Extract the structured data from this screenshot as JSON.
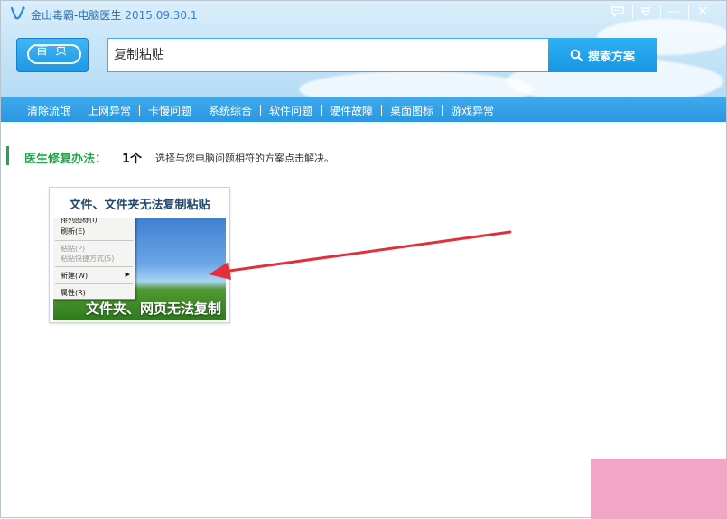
{
  "window": {
    "app_title": "金山毒霸-电脑医生",
    "version": "2015.09.30.1",
    "controls": {
      "chat_icon": "chat-bubble-icon",
      "menu_icon": "menu-icon",
      "minimize_glyph": "—",
      "close_glyph": "✕"
    }
  },
  "header": {
    "home_label": "首 页",
    "search": {
      "value": "复制粘贴",
      "button_label": "搜索方案"
    }
  },
  "nav": {
    "items": [
      "清除流氓",
      "上网异常",
      "卡慢问题",
      "系统综合",
      "软件问题",
      "硬件故障",
      "桌面图标",
      "游戏异常"
    ]
  },
  "results": {
    "label": "医生修复办法：",
    "count": "1个",
    "tip": "选择与您电脑问题相符的方案点击解决。",
    "cards": [
      {
        "title": "文件、文件夹无法复制粘贴",
        "caption": "文件夹、网页无法复制",
        "menu": {
          "items": [
            "排列图标(I)",
            "刷新(E)",
            "粘贴(P)",
            "粘贴快捷方式(S)",
            "新建(W)",
            "属性(R)"
          ]
        }
      }
    ]
  },
  "colors": {
    "accent_blue": "#2b97e0",
    "green": "#1aa94b",
    "arrow_red": "#e0303a"
  }
}
